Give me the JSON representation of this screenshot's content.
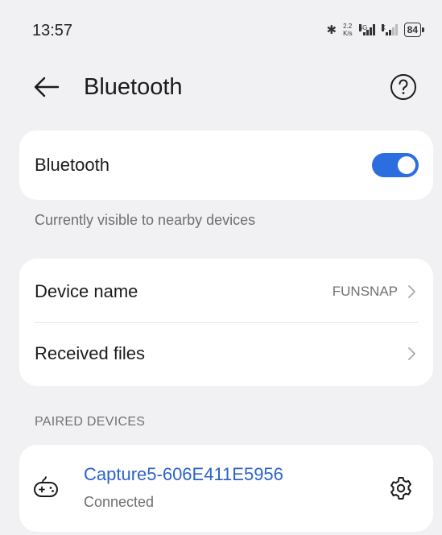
{
  "status_bar": {
    "time": "13:57",
    "speed_top": "2.2",
    "speed_bottom": "K/s",
    "network_tag": "5G",
    "sim2_tag": "X",
    "battery": "84",
    "icons": [
      "bluetooth-icon",
      "signal-icon",
      "signal-icon",
      "battery-icon"
    ]
  },
  "header": {
    "title": "Bluetooth",
    "back_icon": "back-arrow-icon",
    "help_icon": "help-icon"
  },
  "bluetooth_card": {
    "label": "Bluetooth",
    "toggle_on": true,
    "accent": "#2c6ee0"
  },
  "visibility_hint": "Currently visible to nearby devices",
  "info_card": {
    "device_name_label": "Device name",
    "device_name_value": "FUNSNAP",
    "received_files_label": "Received files"
  },
  "paired_section": {
    "title": "PAIRED DEVICES",
    "devices": [
      {
        "name": "Capture5-606E411E5956",
        "status": "Connected",
        "icon": "gamepad-icon",
        "name_color": "#2b63c9"
      }
    ]
  }
}
